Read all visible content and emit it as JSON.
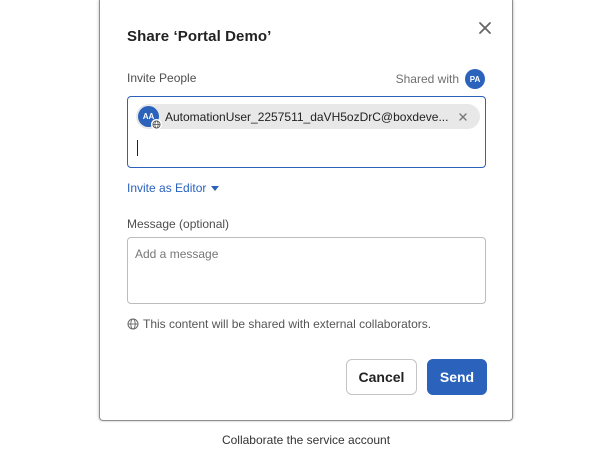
{
  "dialog": {
    "title": "Share ‘Portal Demo’",
    "close_icon": "close-icon"
  },
  "invite": {
    "section_label": "Invite People",
    "shared_with_label": "Shared with",
    "shared_with_avatar_initials": "PA",
    "collaborator": {
      "initials": "AA",
      "email": "AutomationUser_2257511_daVH5ozDrC@boxdeve...",
      "external_icon": "globe-icon",
      "remove_icon": "close-icon"
    },
    "input_value": "",
    "role_label": "Invite as Editor",
    "role_icon": "chevron-down-icon"
  },
  "message": {
    "section_label": "Message (optional)",
    "placeholder": "Add a message",
    "value": ""
  },
  "notice": {
    "icon": "globe-icon",
    "text": "This content will be shared with external collaborators."
  },
  "buttons": {
    "cancel_label": "Cancel",
    "send_label": "Send"
  },
  "caption": "Collaborate the service account",
  "colors": {
    "accent": "#2a62bc",
    "pill_background": "#e8e8e8",
    "border": "#bcbcbc"
  }
}
